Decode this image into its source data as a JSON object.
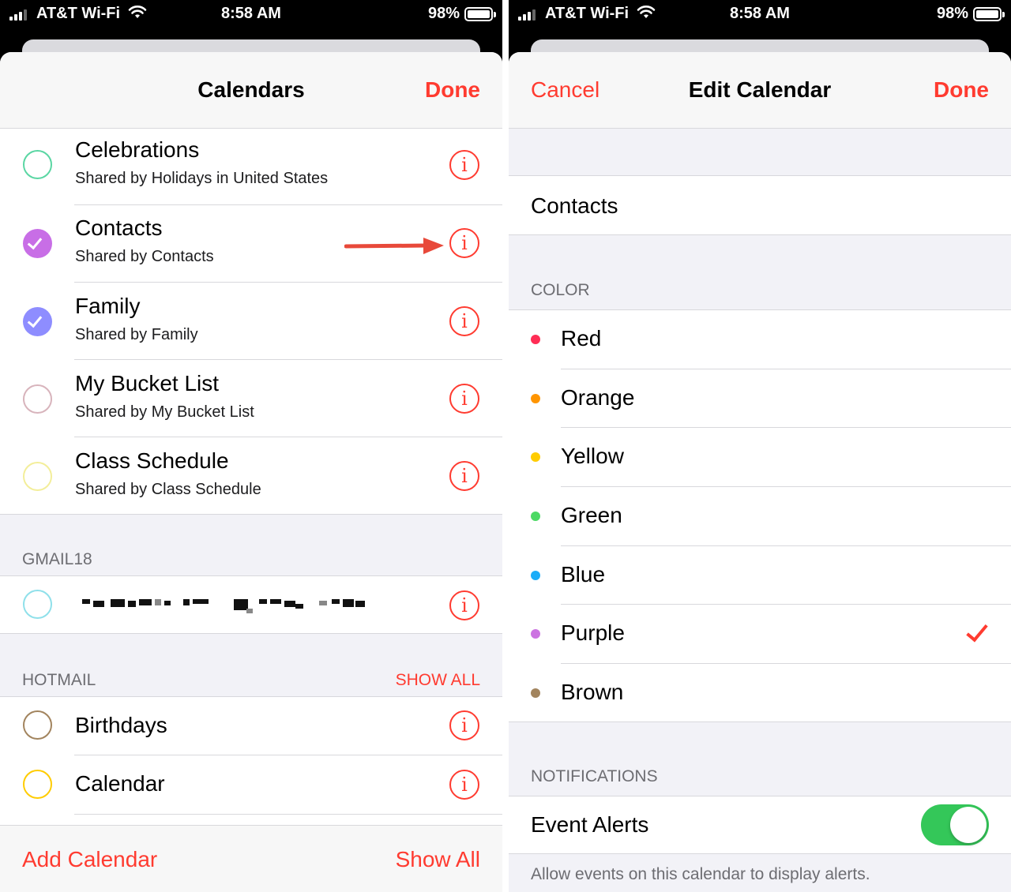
{
  "left": {
    "status": {
      "carrier": "AT&T Wi-Fi",
      "time": "8:58 AM",
      "battery": "98%"
    },
    "nav": {
      "title": "Calendars",
      "done": "Done"
    },
    "shared_calendars": [
      {
        "title": "Celebrations",
        "subtitle": "Shared by Holidays in United States",
        "color": "#5ad6a3",
        "checked": false
      },
      {
        "title": "Contacts",
        "subtitle": "Shared by Contacts",
        "color": "#c86ee6",
        "checked": true
      },
      {
        "title": "Family",
        "subtitle": "Shared by Family",
        "color": "#8e8dff",
        "checked": true
      },
      {
        "title": "My Bucket List",
        "subtitle": "Shared by My Bucket List",
        "color": "#d8b4bc",
        "checked": false
      },
      {
        "title": "Class Schedule",
        "subtitle": "Shared by Class Schedule",
        "color": "#f3ee9a",
        "checked": false
      }
    ],
    "gmail": {
      "header": "GMAIL18",
      "color": "#8fe0ea"
    },
    "hotmail": {
      "header": "HOTMAIL",
      "action": "SHOW ALL",
      "calendars": [
        {
          "title": "Birthdays",
          "color": "#a2845e"
        },
        {
          "title": "Calendar",
          "color": "#ffcc00"
        }
      ]
    },
    "info_glyph": "i",
    "footer": {
      "add": "Add Calendar",
      "show_all": "Show All"
    }
  },
  "right": {
    "status": {
      "carrier": "AT&T Wi-Fi",
      "time": "8:58 AM",
      "battery": "98%"
    },
    "nav": {
      "cancel": "Cancel",
      "title": "Edit Calendar",
      "done": "Done"
    },
    "calendar_name": "Contacts",
    "color_header": "COLOR",
    "colors": [
      {
        "name": "Red",
        "hex": "#ff2d55"
      },
      {
        "name": "Orange",
        "hex": "#ff9500"
      },
      {
        "name": "Yellow",
        "hex": "#ffcc00"
      },
      {
        "name": "Green",
        "hex": "#4cd964"
      },
      {
        "name": "Blue",
        "hex": "#1badf8"
      },
      {
        "name": "Purple",
        "hex": "#cc73e1"
      },
      {
        "name": "Brown",
        "hex": "#a2845e"
      }
    ],
    "selected_color": "Purple",
    "notifications_header": "NOTIFICATIONS",
    "event_alerts": {
      "label": "Event Alerts",
      "on": true
    },
    "footnote": "Allow events on this calendar to display alerts."
  }
}
